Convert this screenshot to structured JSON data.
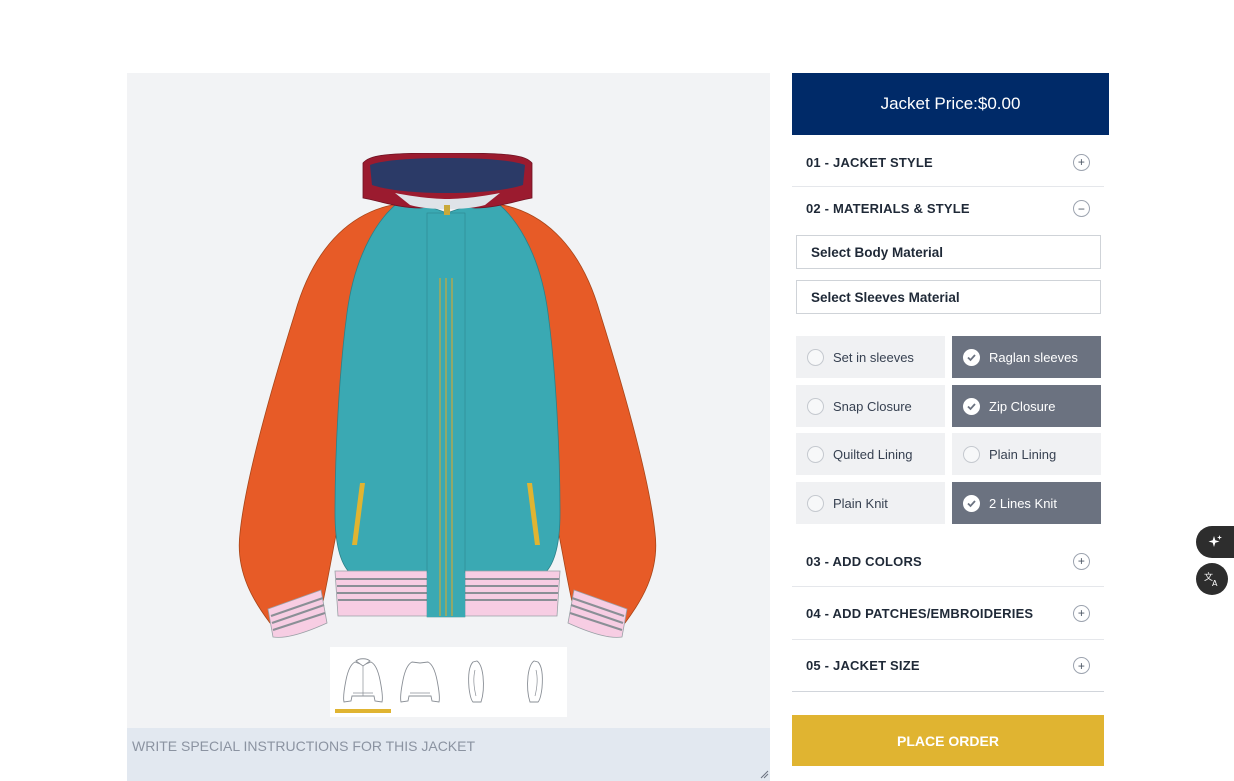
{
  "price": {
    "label": "Jacket Price:",
    "value": "$0.00"
  },
  "sections": [
    {
      "number_title": "01 - JACKET STYLE",
      "state": "+"
    },
    {
      "number_title": "02 - MATERIALS & STYLE",
      "state": "−"
    },
    {
      "number_title": "03 - ADD COLORS",
      "state": "+"
    },
    {
      "number_title": "04 - ADD PATCHES/EMBROIDERIES",
      "state": "+"
    },
    {
      "number_title": "05 - JACKET SIZE",
      "state": "+"
    }
  ],
  "materials": {
    "body_select": "Select Body Material",
    "sleeves_select": "Select Sleeves Material"
  },
  "options": [
    {
      "label": "Set in sleeves",
      "selected": false
    },
    {
      "label": "Raglan sleeves",
      "selected": true
    },
    {
      "label": "Snap Closure",
      "selected": false
    },
    {
      "label": "Zip Closure",
      "selected": true
    },
    {
      "label": "Quilted Lining",
      "selected": false
    },
    {
      "label": "Plain Lining",
      "selected": false
    },
    {
      "label": "Plain Knit",
      "selected": false
    },
    {
      "label": "2 Lines Knit",
      "selected": true
    }
  ],
  "instructions": {
    "placeholder": "WRITE SPECIAL INSTRUCTIONS FOR THIS JACKET"
  },
  "place_order_label": "PLACE ORDER",
  "thumbnails": [
    "front-view",
    "back-view",
    "left-side-view",
    "right-side-view"
  ],
  "colors": {
    "header_bg": "#002a68",
    "accent": "#e0b431",
    "body": "#3aa9b3",
    "sleeves": "#e75b27",
    "hood": "#9b1b2f",
    "hood_lining": "#2b3a67",
    "cuffs": "#f7cde3"
  },
  "icons": [
    "plus-circle-icon",
    "minus-circle-icon",
    "check-circle-icon",
    "ai-sparkle-icon",
    "translate-icon"
  ]
}
